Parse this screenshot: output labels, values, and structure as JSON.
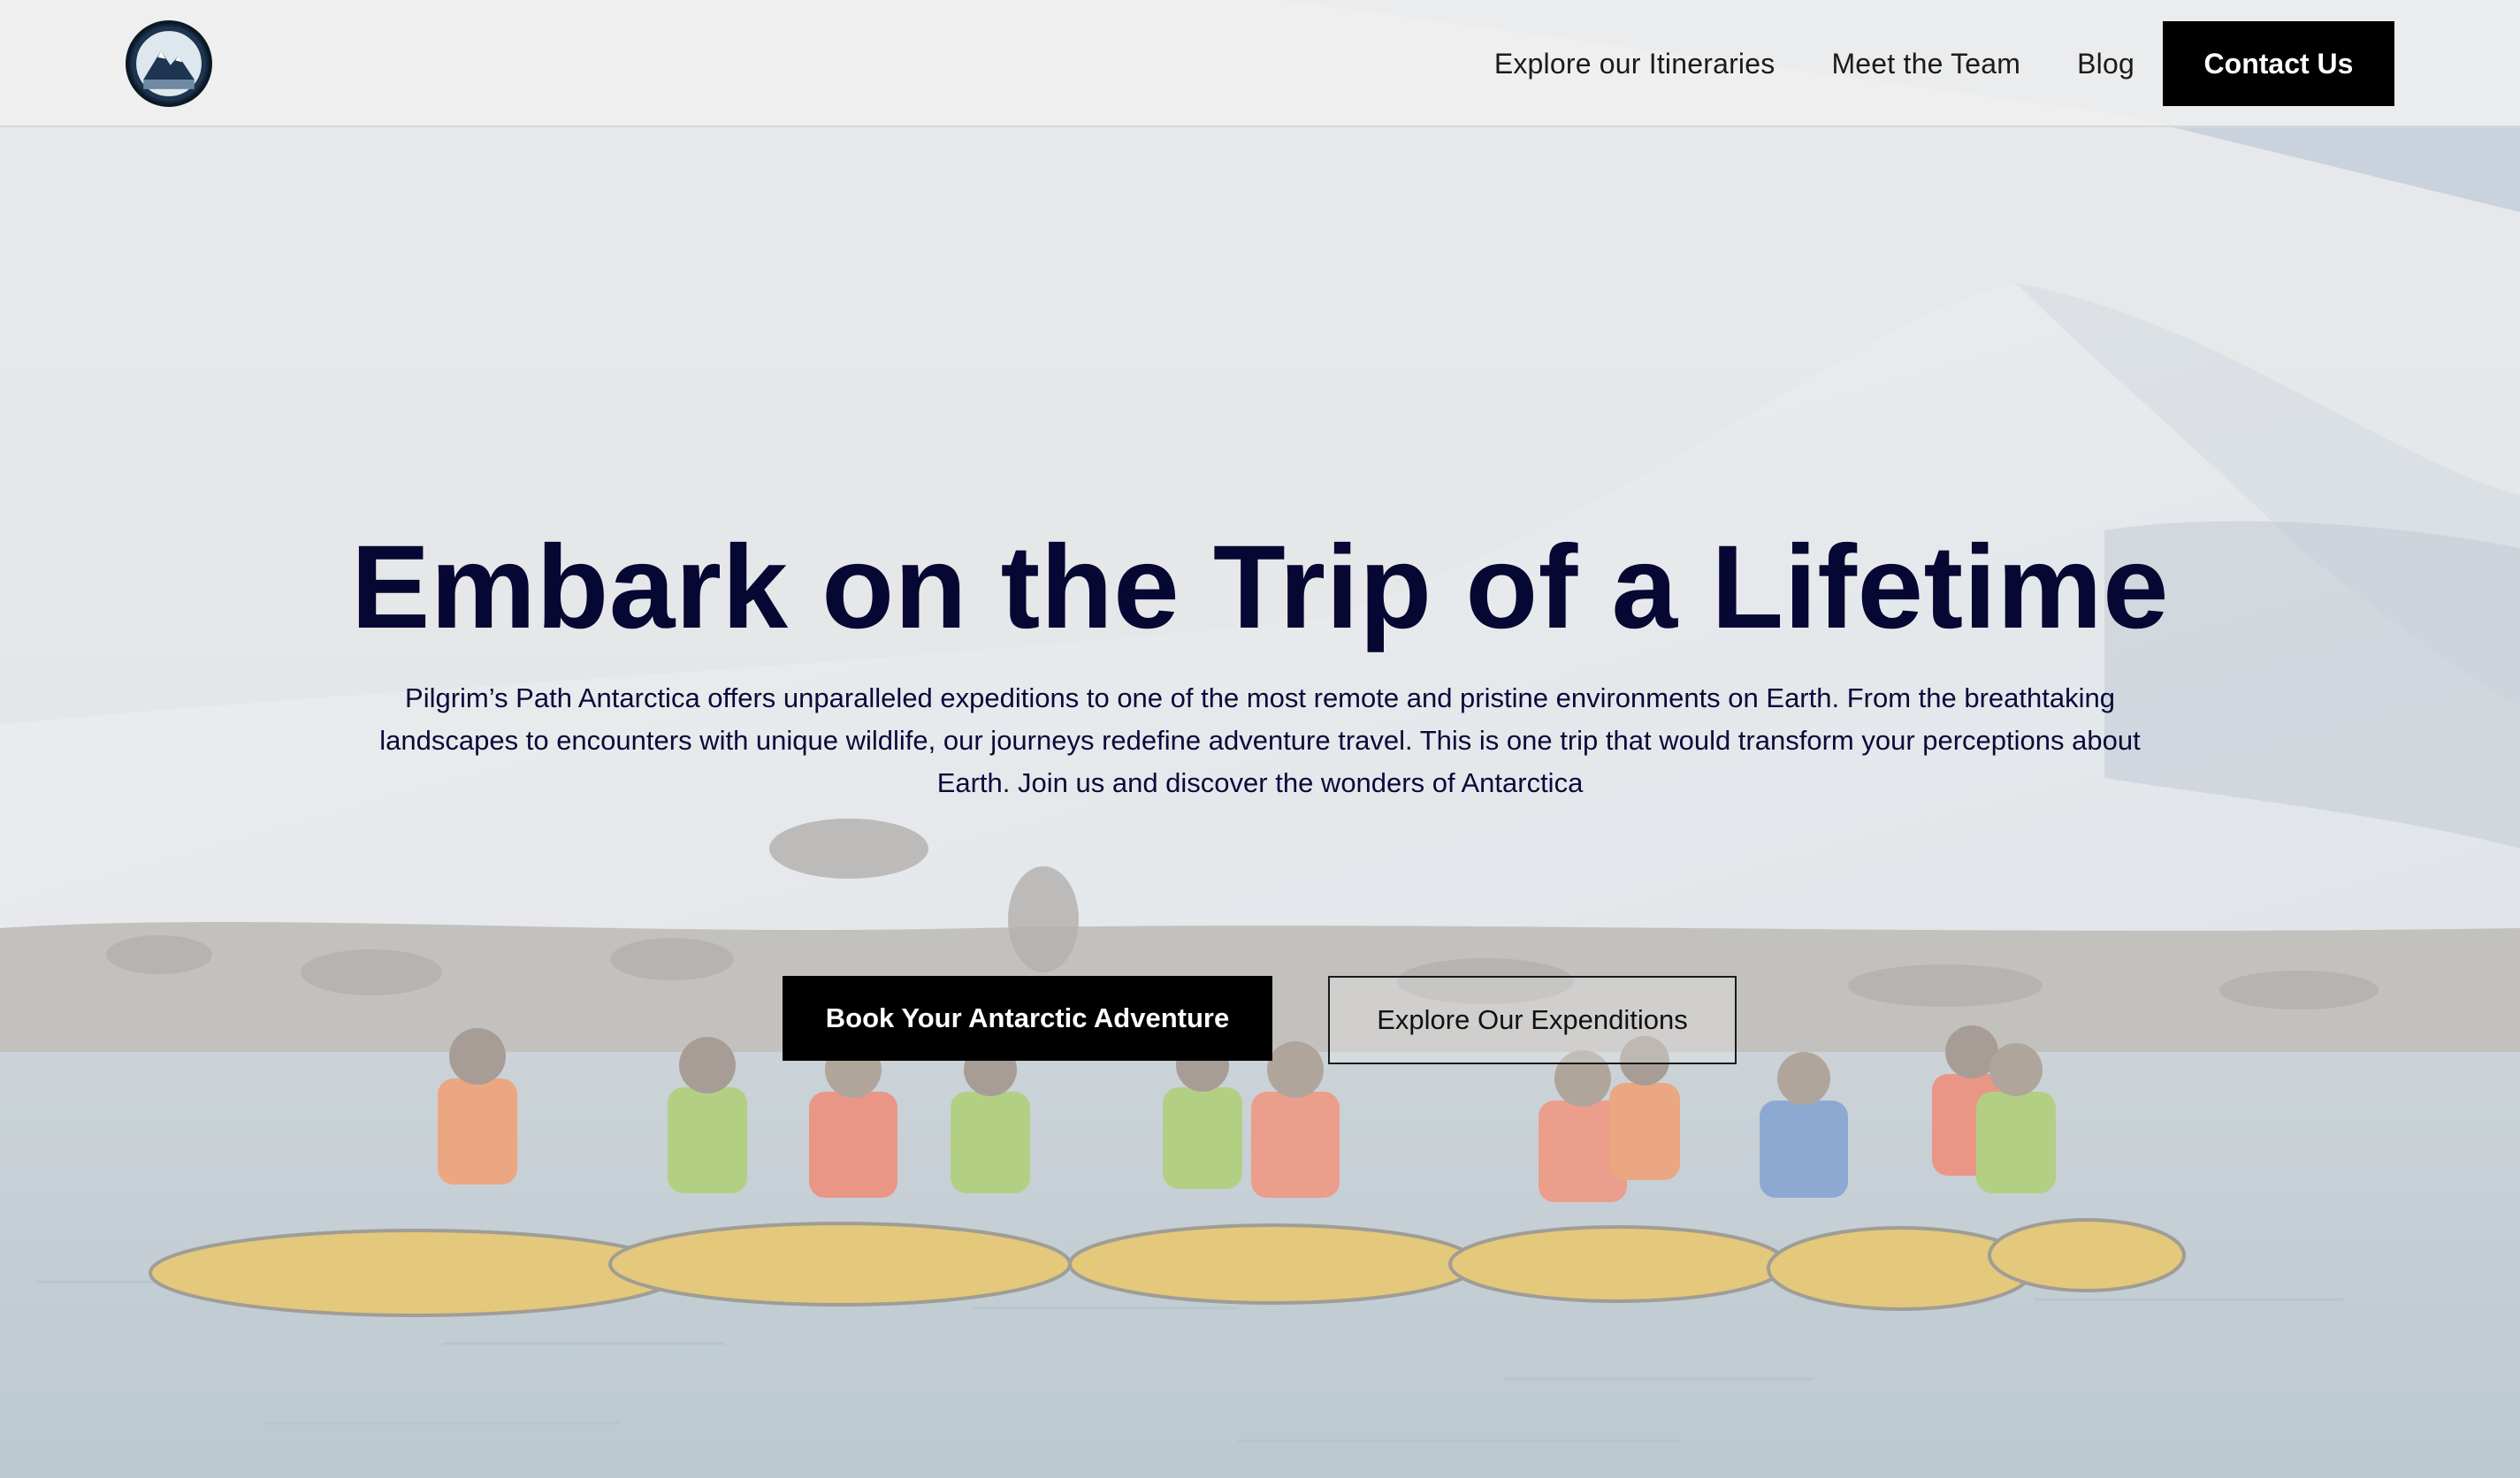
{
  "header": {
    "logo_icon": "mountain-logo-icon",
    "nav": [
      {
        "label": "Explore our Itineraries"
      },
      {
        "label": "Meet the Team"
      },
      {
        "label": "Blog"
      }
    ],
    "contact_label": "Contact Us"
  },
  "hero": {
    "title": "Embark on the Trip of a Lifetime",
    "description": "Pilgrim’s Path Antarctica offers unparalleled expeditions to one of the most remote and pristine environments on Earth. From the breathtaking landscapes to encounters with unique wildlife, our journeys redefine adventure travel. This is one trip that would transform your perceptions about Earth. Join us and discover the wonders of Antarctica",
    "primary_cta": "Book Your Antarctic Adventure",
    "secondary_cta": "Explore Our Expenditions",
    "background_image": "kayakers-antarctica-photo"
  },
  "colors": {
    "headline": "#070733",
    "button_bg": "#000000",
    "button_text": "#ffffff"
  }
}
